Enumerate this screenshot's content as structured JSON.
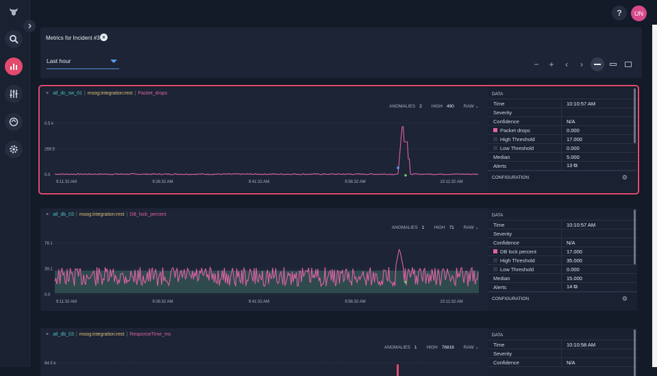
{
  "app": {
    "help_label": "?",
    "user_initials": "UN"
  },
  "sidebar": {
    "items": [
      {
        "name": "logo",
        "icon": "cow-logo-icon"
      },
      {
        "name": "search",
        "icon": "search-icon"
      },
      {
        "name": "metrics",
        "icon": "metrics-icon",
        "active": true
      },
      {
        "name": "integrations",
        "icon": "sliders-icon"
      },
      {
        "name": "sync",
        "icon": "sync-icon"
      },
      {
        "name": "settings",
        "icon": "gear-icon"
      }
    ]
  },
  "header": {
    "title": "Metrics for Incident #3",
    "time_range": "Last hour",
    "controls": [
      "−",
      "+",
      "‹",
      "›"
    ]
  },
  "colors": {
    "accent": "#e24b6d",
    "metric": "#e262a6",
    "host": "#4fc3c3",
    "source": "#e0c078",
    "band": "#2e4a4d"
  },
  "cards": [
    {
      "selected": true,
      "close": "×",
      "host": "atl_dc_sw_01",
      "source": "moog:integration:rest",
      "metric": "Packet_drops",
      "anomalies_label": "ANOMALIES",
      "anomalies": "2",
      "high_label": "HIGH",
      "high": "490",
      "mode": "RAW",
      "yticks": [
        "0.5 k",
        "269.5",
        "0.0"
      ],
      "xticks": [
        "9:11:32 AM",
        "9:26:32 AM",
        "9:41:32 AM",
        "9:56:32 AM",
        "10:11:32 AM"
      ],
      "data_header": "DATA",
      "rows": [
        {
          "k": "Time",
          "v": "10:10:57 AM"
        },
        {
          "k": "Severity",
          "v": ""
        },
        {
          "k": "Confidence",
          "v": "N/A"
        },
        {
          "k": "Packet drops",
          "v": "0.000",
          "sw": "#e262a6"
        },
        {
          "k": "High Threshold",
          "v": "17.000",
          "sw": "#2c3a4a"
        },
        {
          "k": "Low Threshold",
          "v": "0.000",
          "sw": "#2c3a4a"
        },
        {
          "k": "Median",
          "v": "5.000"
        },
        {
          "k": "Alerts",
          "v": "13 ⧉"
        }
      ],
      "config_header": "CONFIGURATION"
    },
    {
      "selected": false,
      "close": "×",
      "host": "atl_db_03",
      "source": "moog:integration:rest",
      "metric": "DB_lock_percent",
      "anomalies_label": "ANOMALIES",
      "anomalies": "1",
      "high_label": "HIGH",
      "high": "71",
      "mode": "RAW",
      "yticks": [
        "78.1",
        "39.1",
        "0.0"
      ],
      "xticks": [
        "9:11:32 AM",
        "9:26:32 AM",
        "9:41:32 AM",
        "9:56:32 AM",
        "10:11:32 AM"
      ],
      "data_header": "DATA",
      "rows": [
        {
          "k": "Time",
          "v": "10:10:57 AM"
        },
        {
          "k": "Severity",
          "v": ""
        },
        {
          "k": "Confidence",
          "v": "N/A"
        },
        {
          "k": "DB lock percent",
          "v": "17.000",
          "sw": "#e262a6"
        },
        {
          "k": "High Threshold",
          "v": "35.000",
          "sw": "#2c3a4a"
        },
        {
          "k": "Low Threshold",
          "v": "0.000",
          "sw": "#2c3a4a"
        },
        {
          "k": "Median",
          "v": "15.000"
        },
        {
          "k": "Alerts",
          "v": "14 ⧉"
        }
      ],
      "config_header": "CONFIGURATION"
    },
    {
      "selected": false,
      "close": "×",
      "host": "atl_db_03",
      "source": "moog:integration:rest",
      "metric": "ResponseTime_ms",
      "anomalies_label": "ANOMALIES",
      "anomalies": "1",
      "high_label": "HIGH",
      "high": "76816",
      "mode": "RAW",
      "yticks": [
        "84.5 k"
      ],
      "xticks": [],
      "data_header": "DATA",
      "rows": [
        {
          "k": "Time",
          "v": "10:10:58 AM"
        },
        {
          "k": "Severity",
          "v": ""
        },
        {
          "k": "Confidence",
          "v": "N/A"
        }
      ],
      "config_header": ""
    }
  ]
}
